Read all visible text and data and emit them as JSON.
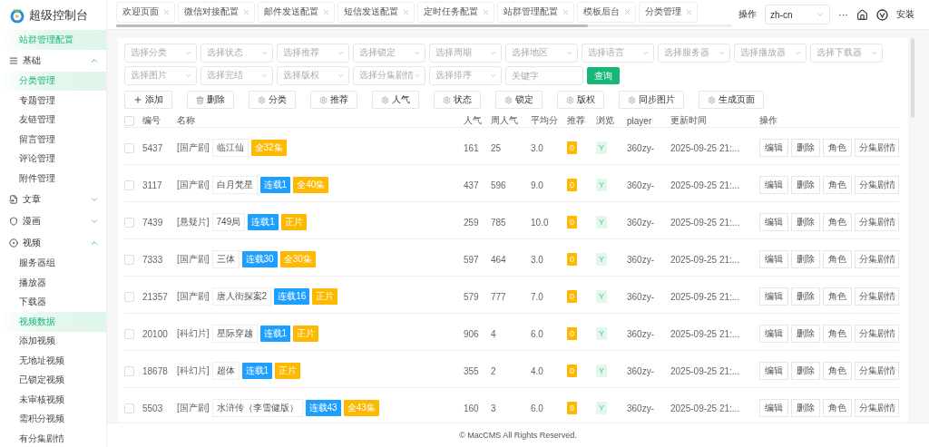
{
  "brand": {
    "title": "超级控制台"
  },
  "sidebar": {
    "items": [
      {
        "kind": "link",
        "label": "站群管理配置",
        "selected": true
      },
      {
        "kind": "group",
        "label": "基础",
        "expanded": true,
        "children": [
          {
            "label": "分类管理",
            "selected": true
          },
          {
            "label": "专题管理",
            "selected": false
          },
          {
            "label": "友链管理",
            "selected": false
          },
          {
            "label": "留言管理",
            "selected": false
          },
          {
            "label": "评论管理",
            "selected": false
          },
          {
            "label": "附件管理",
            "selected": false
          }
        ]
      },
      {
        "kind": "group",
        "label": "文章",
        "expanded": false
      },
      {
        "kind": "group",
        "label": "漫画",
        "expanded": false
      },
      {
        "kind": "group",
        "label": "视频",
        "expanded": true,
        "children": [
          {
            "label": "服务器组",
            "selected": false
          },
          {
            "label": "播放器",
            "selected": false
          },
          {
            "label": "下载器",
            "selected": false
          },
          {
            "label": "视频数据",
            "selected": true
          },
          {
            "label": "添加视频",
            "selected": false
          },
          {
            "label": "无地址视频",
            "selected": false
          },
          {
            "label": "已锁定视频",
            "selected": false
          },
          {
            "label": "未审核视频",
            "selected": false
          },
          {
            "label": "需积分视频",
            "selected": false
          },
          {
            "label": "有分集剧情",
            "selected": false
          }
        ]
      }
    ]
  },
  "tabs": [
    {
      "label": "欢迎页面",
      "selected": false
    },
    {
      "label": "微信对接配置",
      "selected": false
    },
    {
      "label": "邮件发送配置",
      "selected": false
    },
    {
      "label": "短信发送配置",
      "selected": false
    },
    {
      "label": "定时任务配置",
      "selected": false
    },
    {
      "label": "站群管理配置",
      "selected": false
    },
    {
      "label": "模板后台",
      "selected": false
    },
    {
      "label": "分类管理",
      "selected": false
    }
  ],
  "header": {
    "action_label": "操作",
    "language": "zh-cn",
    "more": "···",
    "install": "安装"
  },
  "filters": {
    "row_1": [
      "选择分类",
      "选择状态",
      "选择推荐",
      "选择锁定",
      "选择周期",
      "选择地区",
      "选择语言",
      "选择服务器",
      "选择播放器",
      "选择下载器"
    ],
    "row_2": [
      "选择图片",
      "选择完结",
      "选择版权",
      "选择分集剧情",
      "选择排序"
    ],
    "keyword_placeholder": "关键字",
    "search_button": "查询"
  },
  "toolbar": [
    {
      "kind": "add",
      "label": "添加"
    },
    {
      "kind": "delete",
      "label": "删除"
    },
    {
      "kind": "gear",
      "label": "分类"
    },
    {
      "kind": "gear",
      "label": "推荐"
    },
    {
      "kind": "gear",
      "label": "人气"
    },
    {
      "kind": "gear",
      "label": "状态"
    },
    {
      "kind": "gear",
      "label": "锁定"
    },
    {
      "kind": "gear",
      "label": "版权"
    },
    {
      "kind": "gear",
      "label": "同步图片"
    },
    {
      "kind": "gear",
      "label": "生成页面"
    }
  ],
  "table": {
    "all_checked": false,
    "columns": [
      "编号",
      "名称",
      "人气",
      "周人气",
      "平均分",
      "推荐",
      "浏览",
      "player",
      "更新时间",
      "操作"
    ],
    "rows": [
      {
        "checked": false,
        "id": "5437",
        "category": "[国产剧]",
        "name": "临江仙",
        "tags": [
          {
            "text": "全32集",
            "color": "#ffb800"
          }
        ],
        "hits": "161",
        "week_hits": "25",
        "score": "3.0",
        "recommend": "0",
        "browse": "Y",
        "player": "360zy-",
        "updated": "2025-09-25 21:...",
        "actions": [
          "编辑",
          "删除",
          "角色",
          "分集剧情"
        ]
      },
      {
        "checked": false,
        "id": "3117",
        "category": "[国产剧]",
        "name": "白月梵星",
        "tags": [
          {
            "text": "连载1",
            "color": "#1e9fff"
          },
          {
            "text": "全40集",
            "color": "#ffb800"
          }
        ],
        "hits": "437",
        "week_hits": "596",
        "score": "9.0",
        "recommend": "0",
        "browse": "Y",
        "player": "360zy-",
        "updated": "2025-09-25 21:...",
        "actions": [
          "编辑",
          "删除",
          "角色",
          "分集剧情"
        ]
      },
      {
        "checked": false,
        "id": "7439",
        "category": "[悬疑片]",
        "name": "749局",
        "tags": [
          {
            "text": "连载1",
            "color": "#1e9fff"
          },
          {
            "text": "正片",
            "color": "#ffb800"
          }
        ],
        "hits": "259",
        "week_hits": "785",
        "score": "10.0",
        "recommend": "0",
        "browse": "Y",
        "player": "360zy-",
        "updated": "2025-09-25 21:...",
        "actions": [
          "编辑",
          "删除",
          "角色",
          "分集剧情"
        ]
      },
      {
        "checked": false,
        "id": "7333",
        "category": "[国产剧]",
        "name": "三体",
        "tags": [
          {
            "text": "连载30",
            "color": "#1e9fff"
          },
          {
            "text": "全30集",
            "color": "#ffb800"
          }
        ],
        "hits": "597",
        "week_hits": "464",
        "score": "3.0",
        "recommend": "0",
        "browse": "Y",
        "player": "360zy-",
        "updated": "2025-09-25 21:...",
        "actions": [
          "编辑",
          "删除",
          "角色",
          "分集剧情"
        ]
      },
      {
        "checked": false,
        "id": "21357",
        "category": "[国产剧]",
        "name": "唐人街探案2",
        "tags": [
          {
            "text": "连载16",
            "color": "#1e9fff"
          },
          {
            "text": "正片",
            "color": "#ffb800"
          }
        ],
        "hits": "579",
        "week_hits": "777",
        "score": "7.0",
        "recommend": "0",
        "browse": "Y",
        "player": "360zy-",
        "updated": "2025-09-25 21:...",
        "actions": [
          "编辑",
          "删除",
          "角色",
          "分集剧情"
        ]
      },
      {
        "checked": false,
        "id": "20100",
        "category": "[科幻片]",
        "name": "星际穿越",
        "tags": [
          {
            "text": "连载1",
            "color": "#1e9fff"
          },
          {
            "text": "正片",
            "color": "#ffb800"
          }
        ],
        "hits": "906",
        "week_hits": "4",
        "score": "6.0",
        "recommend": "0",
        "browse": "Y",
        "player": "360zy-",
        "updated": "2025-09-25 21:...",
        "actions": [
          "编辑",
          "删除",
          "角色",
          "分集剧情"
        ]
      },
      {
        "checked": false,
        "id": "18678",
        "category": "[科幻片]",
        "name": "超体",
        "tags": [
          {
            "text": "连载1",
            "color": "#1e9fff"
          },
          {
            "text": "正片",
            "color": "#ffb800"
          }
        ],
        "hits": "355",
        "week_hits": "2",
        "score": "4.0",
        "recommend": "0",
        "browse": "Y",
        "player": "360zy-",
        "updated": "2025-09-25 21:...",
        "actions": [
          "编辑",
          "删除",
          "角色",
          "分集剧情"
        ]
      },
      {
        "checked": false,
        "id": "5503",
        "category": "[国产剧]",
        "name": "水浒传（李雪健版）",
        "tags": [
          {
            "text": "连载43",
            "color": "#1e9fff"
          },
          {
            "text": "全43集",
            "color": "#ffb800"
          }
        ],
        "hits": "160",
        "week_hits": "3",
        "score": "6.0",
        "recommend": "9",
        "browse": "Y",
        "player": "360zy-",
        "updated": "2025-09-25 21:...",
        "actions": [
          "编辑",
          "删除",
          "角色",
          "分集剧情"
        ]
      }
    ]
  },
  "footer": "© MacCMS All Rights Reserved."
}
